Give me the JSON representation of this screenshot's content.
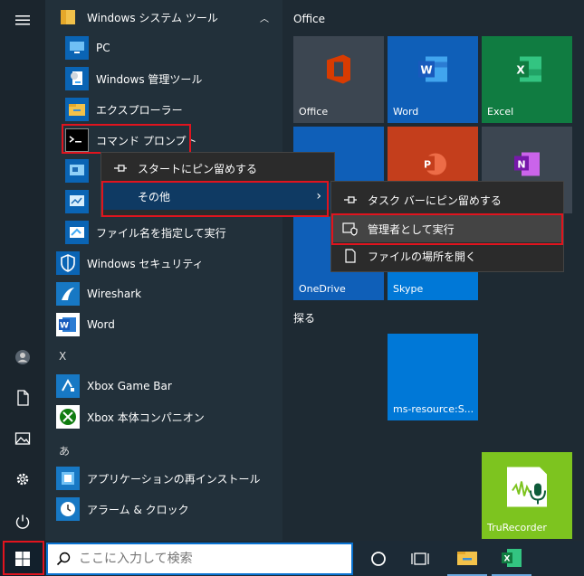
{
  "applist": {
    "group_windows_tools": "Windows システム ツール",
    "items_top": [
      {
        "label": "PC"
      },
      {
        "label": "Windows 管理ツール"
      },
      {
        "label": "エクスプローラー"
      },
      {
        "label": "コマンド プロンプト"
      }
    ],
    "items_mid": [
      {
        "label": "ファイル名を指定して実行"
      },
      {
        "label": "Windows セキュリティ"
      },
      {
        "label": "Wireshark"
      },
      {
        "label": "Word"
      }
    ],
    "letter_x": "X",
    "items_x": [
      {
        "label": "Xbox Game Bar"
      },
      {
        "label": "Xbox 本体コンパニオン"
      }
    ],
    "letter_a": "あ",
    "items_a": [
      {
        "label": "アプリケーションの再インストール"
      },
      {
        "label": "アラーム & クロック"
      }
    ]
  },
  "context_menu": {
    "pin_start": "スタートにピン留めする",
    "more": "その他"
  },
  "submenu": {
    "pin_taskbar": "タスク バーにピン留めする",
    "run_admin": "管理者として実行",
    "open_location": "ファイルの場所を開く"
  },
  "tiles": {
    "group_office": "Office",
    "office": "Office",
    "word": "Word",
    "excel": "Excel",
    "onedrive": "OneDrive",
    "skype": "Skype",
    "group_explore": "探る",
    "ms_resource": "ms-resource:S...",
    "trurecorder": "TruRecorder"
  },
  "taskbar": {
    "search_placeholder": "ここに入力して検索"
  },
  "colors": {
    "highlight": "#e0141e",
    "accent": "#0078d7"
  }
}
